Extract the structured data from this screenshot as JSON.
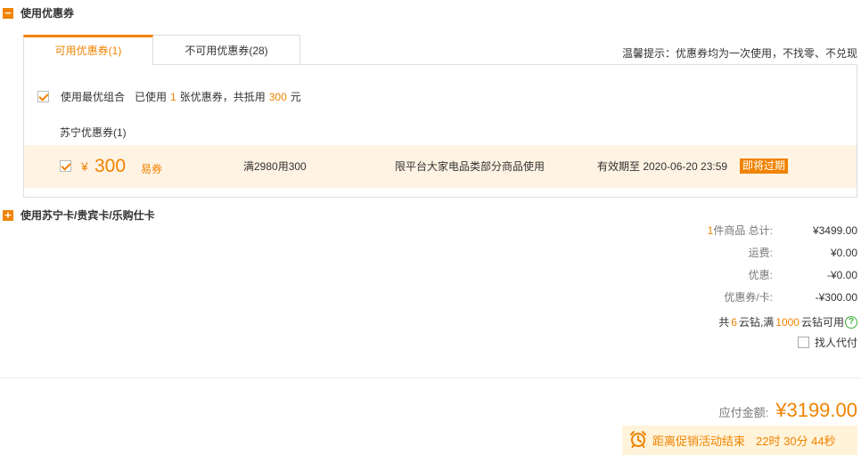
{
  "coupon_section": {
    "toggle": "−",
    "title": "使用优惠券"
  },
  "tabs": [
    {
      "label": "可用优惠券(1)",
      "active": true
    },
    {
      "label": "不可用优惠券(28)",
      "active": false
    }
  ],
  "notice": "温馨提示：优惠券均为一次使用，不找零、不兑现",
  "best_combo": {
    "label": "使用最优组合",
    "checked": true,
    "used_prefix": "已使用",
    "used_count": "1",
    "used_mid": "张优惠券，共抵用",
    "used_amount": "300",
    "used_suffix": "元"
  },
  "store_label": "苏宁优惠券(1)",
  "coupon": {
    "checked": true,
    "currency": "¥",
    "amount": "300",
    "type": "易券",
    "condition": "满2980用300",
    "scope": "限平台大家电品类部分商品使用",
    "validity": "有效期至 2020-06-20 23:59",
    "badge": "即将过期"
  },
  "card_section": {
    "toggle": "+",
    "title": "使用苏宁卡/贵宾卡/乐购仕卡"
  },
  "summary": {
    "items_count": "1",
    "items_label": "件商品 总计:",
    "items_total": "¥3499.00",
    "shipping_label": "运费:",
    "shipping": "¥0.00",
    "discount_label": "优惠:",
    "discount": "-¥0.00",
    "coupon_label": "优惠券/卡:",
    "coupon_value": "-¥300.00"
  },
  "cloud_diamond": {
    "prefix": "共",
    "count": "6",
    "mid": "云钻,满",
    "threshold": "1000",
    "suffix": "云钻可用",
    "help": "?"
  },
  "proxy_pay": {
    "label": "找人代付",
    "checked": false
  },
  "payable": {
    "label": "应付金额:",
    "value": "¥3199.00"
  },
  "promo": {
    "label": "距离促销活动结束",
    "countdown": "22时 30分 44秒",
    "icon": "alarm-clock-icon",
    "accent": "#f08300"
  }
}
